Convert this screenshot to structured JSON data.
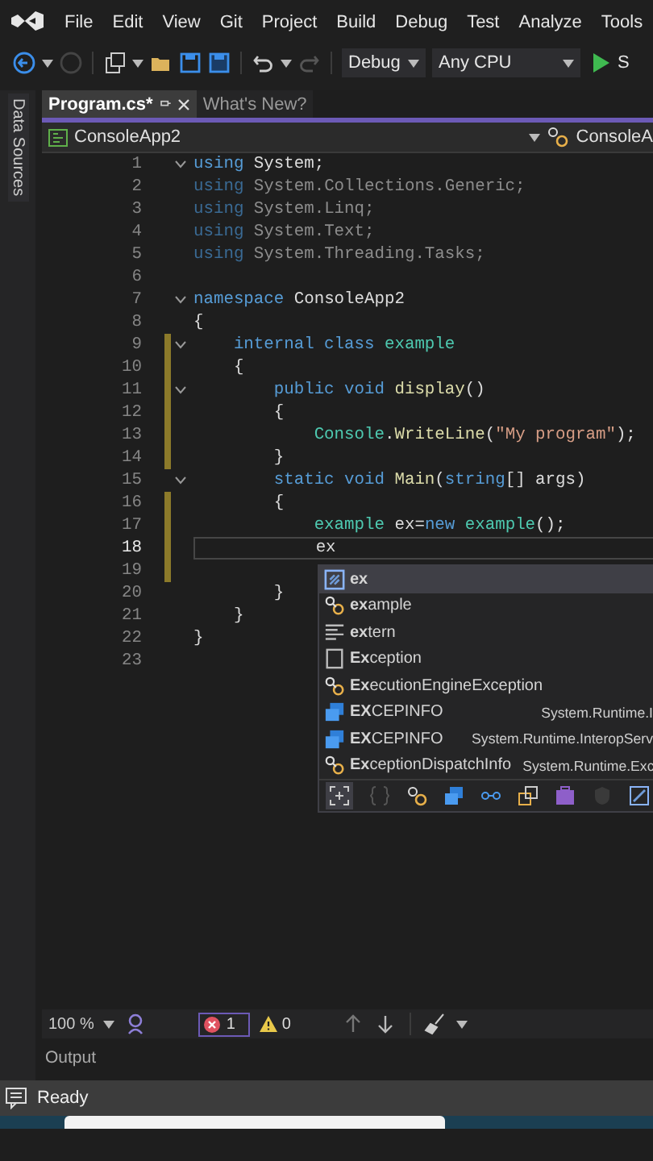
{
  "menu": [
    "File",
    "Edit",
    "View",
    "Git",
    "Project",
    "Build",
    "Debug",
    "Test",
    "Analyze",
    "Tools"
  ],
  "toolbar": {
    "configuration": "Debug",
    "platform": "Any CPU",
    "start": "S"
  },
  "side_panel": {
    "label": "Data Sources"
  },
  "tabs": [
    {
      "label": "Program.cs*",
      "selected": true
    },
    {
      "label": "What's New?",
      "selected": false
    }
  ],
  "nav_bar": {
    "project": "ConsoleApp2",
    "member": "ConsoleA"
  },
  "code_lines": [
    {
      "number": "1",
      "foldable": true,
      "changed": false,
      "current": false,
      "tokens": [
        {
          "kind": "keyword",
          "text": "using"
        },
        {
          "kind": "plain",
          "text": " System;"
        }
      ]
    },
    {
      "number": "2",
      "foldable": false,
      "changed": false,
      "current": false,
      "tokens": [
        {
          "kind": "dim-keyword",
          "text": "using"
        },
        {
          "kind": "dim",
          "text": " System.Collections.Generic;"
        }
      ]
    },
    {
      "number": "3",
      "foldable": false,
      "changed": false,
      "current": false,
      "tokens": [
        {
          "kind": "dim-keyword",
          "text": "using"
        },
        {
          "kind": "dim",
          "text": " System.Linq;"
        }
      ]
    },
    {
      "number": "4",
      "foldable": false,
      "changed": false,
      "current": false,
      "tokens": [
        {
          "kind": "dim-keyword",
          "text": "using"
        },
        {
          "kind": "dim",
          "text": " System.Text;"
        }
      ]
    },
    {
      "number": "5",
      "foldable": false,
      "changed": false,
      "current": false,
      "tokens": [
        {
          "kind": "dim-keyword",
          "text": "using"
        },
        {
          "kind": "dim",
          "text": " System.Threading.Tasks;"
        }
      ]
    },
    {
      "number": "6",
      "foldable": false,
      "changed": false,
      "current": false
    },
    {
      "number": "7",
      "foldable": true,
      "changed": false,
      "current": false,
      "tokens": [
        {
          "kind": "keyword",
          "text": "namespace"
        },
        {
          "kind": "plain",
          "text": " ConsoleApp2"
        }
      ]
    },
    {
      "number": "8",
      "foldable": false,
      "changed": false,
      "current": false,
      "tokens": [
        {
          "kind": "plain",
          "text": "{"
        }
      ]
    },
    {
      "number": "9",
      "foldable": true,
      "changed": true,
      "current": false,
      "tokens": [
        {
          "kind": "keyword",
          "text": "    internal class"
        },
        {
          "kind": "type",
          "text": " example"
        }
      ]
    },
    {
      "number": "10",
      "foldable": false,
      "changed": true,
      "current": false,
      "tokens": [
        {
          "kind": "plain",
          "text": "    {"
        }
      ]
    },
    {
      "number": "11",
      "foldable": true,
      "changed": true,
      "current": false,
      "tokens": [
        {
          "kind": "keyword",
          "text": "        public void"
        },
        {
          "kind": "method",
          "text": " display"
        },
        {
          "kind": "plain",
          "text": "()"
        }
      ]
    },
    {
      "number": "12",
      "foldable": false,
      "changed": true,
      "current": false,
      "tokens": [
        {
          "kind": "plain",
          "text": "        {"
        }
      ]
    },
    {
      "number": "13",
      "foldable": false,
      "changed": true,
      "current": false,
      "tokens": [
        {
          "kind": "type",
          "text": "            Console"
        },
        {
          "kind": "plain",
          "text": "."
        },
        {
          "kind": "method",
          "text": "WriteLine"
        },
        {
          "kind": "plain",
          "text": "("
        },
        {
          "kind": "string",
          "text": "\"My program\""
        },
        {
          "kind": "plain",
          "text": ");"
        }
      ]
    },
    {
      "number": "14",
      "foldable": false,
      "changed": true,
      "current": false,
      "tokens": [
        {
          "kind": "plain",
          "text": "        }"
        }
      ]
    },
    {
      "number": "15",
      "foldable": true,
      "changed": false,
      "current": false,
      "tokens": [
        {
          "kind": "keyword",
          "text": "        static void"
        },
        {
          "kind": "method",
          "text": " Main"
        },
        {
          "kind": "plain",
          "text": "("
        },
        {
          "kind": "keyword",
          "text": "string"
        },
        {
          "kind": "plain",
          "text": "[] args)"
        }
      ]
    },
    {
      "number": "16",
      "foldable": false,
      "changed": true,
      "current": false,
      "tokens": [
        {
          "kind": "plain",
          "text": "        {"
        }
      ]
    },
    {
      "number": "17",
      "foldable": false,
      "changed": true,
      "current": false,
      "tokens": [
        {
          "kind": "type",
          "text": "            example"
        },
        {
          "kind": "plain",
          "text": " ex="
        },
        {
          "kind": "keyword",
          "text": "new"
        },
        {
          "kind": "type",
          "text": " example"
        },
        {
          "kind": "plain",
          "text": "();"
        }
      ]
    },
    {
      "number": "18",
      "foldable": false,
      "changed": true,
      "current": true,
      "tokens": [
        {
          "kind": "plain",
          "text": "            ex"
        }
      ]
    },
    {
      "number": "19",
      "foldable": false,
      "changed": true,
      "current": false
    },
    {
      "number": "20",
      "foldable": false,
      "changed": false,
      "current": false,
      "tokens": [
        {
          "kind": "plain",
          "text": "        }"
        }
      ]
    },
    {
      "number": "21",
      "foldable": false,
      "changed": false,
      "current": false,
      "tokens": [
        {
          "kind": "plain",
          "text": "    }"
        }
      ]
    },
    {
      "number": "22",
      "foldable": false,
      "changed": false,
      "current": false,
      "tokens": [
        {
          "kind": "plain",
          "text": "}"
        }
      ]
    },
    {
      "number": "23",
      "foldable": false,
      "changed": false,
      "current": false
    }
  ],
  "completion": [
    {
      "label": "**ex**",
      "kind": "local",
      "selected": true
    },
    {
      "label": "**ex**ample",
      "kind": "class",
      "selected": false
    },
    {
      "label": "**ex**tern",
      "kind": "keyword",
      "selected": false
    },
    {
      "label": "**Ex**ception",
      "kind": "snippet",
      "selected": false
    },
    {
      "label": "**Ex**ecutionEngineException",
      "kind": "class",
      "selected": false
    },
    {
      "label": "**EX**CEPINFO",
      "detail": "System.Runtime.I",
      "kind": "struct",
      "selected": false
    },
    {
      "label": "**EX**CEPINFO",
      "detail": "System.Runtime.InteropServ",
      "kind": "struct",
      "selected": false
    },
    {
      "label": "**Ex**ceptionDispatchInfo",
      "detail": "System.Runtime.Exc",
      "kind": "class",
      "selected": false
    }
  ],
  "status_row": {
    "zoom": "100 %",
    "errors": "1",
    "warnings": "0"
  },
  "output_tab": "Output",
  "status_bar": "Ready"
}
